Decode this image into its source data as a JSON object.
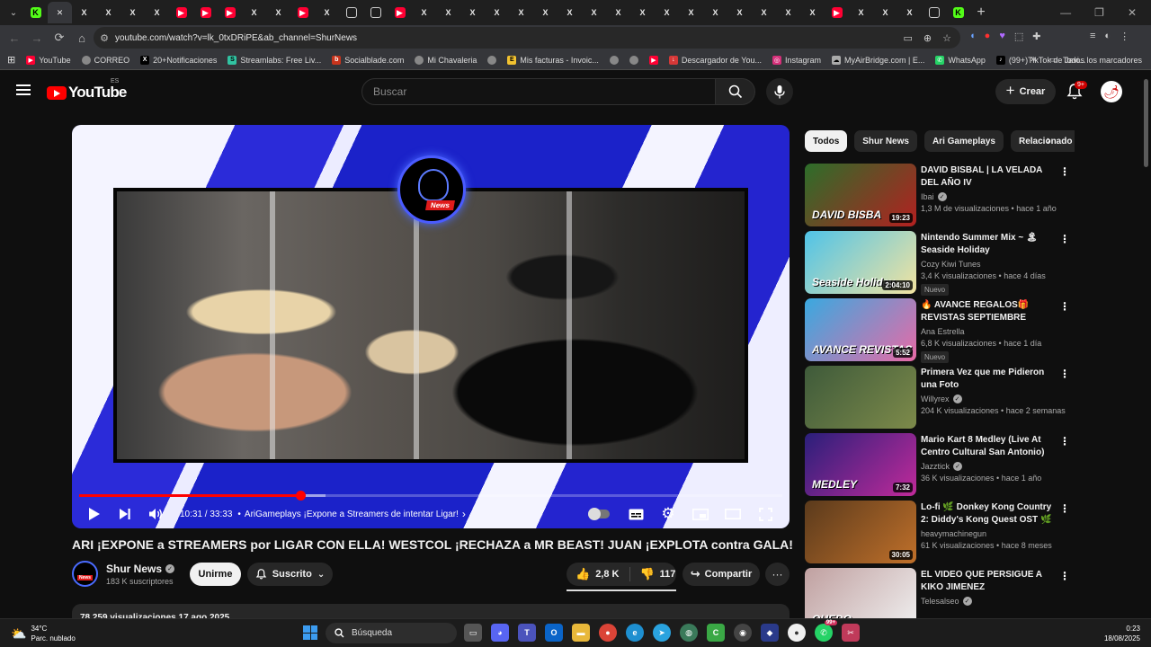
{
  "browser": {
    "tabs": [
      {
        "icon": "k",
        "glyph": "K"
      },
      {
        "icon": "x",
        "glyph": "✕",
        "active": true
      },
      {
        "icon": "x",
        "glyph": "X"
      },
      {
        "icon": "x",
        "glyph": "X"
      },
      {
        "icon": "x",
        "glyph": "X"
      },
      {
        "icon": "x",
        "glyph": "X"
      },
      {
        "icon": "yt",
        "glyph": "▶"
      },
      {
        "icon": "yt",
        "glyph": "▶"
      },
      {
        "icon": "yt",
        "glyph": "▶"
      },
      {
        "icon": "x",
        "glyph": "X"
      },
      {
        "icon": "x",
        "glyph": "X"
      },
      {
        "icon": "yt",
        "glyph": "▶"
      },
      {
        "icon": "x",
        "glyph": "X"
      },
      {
        "icon": "web",
        "glyph": ""
      },
      {
        "icon": "web",
        "glyph": ""
      },
      {
        "icon": "yt",
        "glyph": "▶"
      },
      {
        "icon": "x",
        "glyph": "X"
      },
      {
        "icon": "x",
        "glyph": "X"
      },
      {
        "icon": "x",
        "glyph": "X"
      },
      {
        "icon": "x",
        "glyph": "X"
      },
      {
        "icon": "x",
        "glyph": "X"
      },
      {
        "icon": "x",
        "glyph": "X"
      },
      {
        "icon": "x",
        "glyph": "X"
      },
      {
        "icon": "x",
        "glyph": "X"
      },
      {
        "icon": "x",
        "glyph": "X"
      },
      {
        "icon": "x",
        "glyph": "X"
      },
      {
        "icon": "x",
        "glyph": "X"
      },
      {
        "icon": "x",
        "glyph": "X"
      },
      {
        "icon": "x",
        "glyph": "X"
      },
      {
        "icon": "x",
        "glyph": "X"
      },
      {
        "icon": "x",
        "glyph": "X"
      },
      {
        "icon": "x",
        "glyph": "X"
      },
      {
        "icon": "x",
        "glyph": "X"
      },
      {
        "icon": "yt",
        "glyph": "▶"
      },
      {
        "icon": "x",
        "glyph": "X"
      },
      {
        "icon": "x",
        "glyph": "X"
      },
      {
        "icon": "x",
        "glyph": "X"
      },
      {
        "icon": "web",
        "glyph": ""
      },
      {
        "icon": "k",
        "glyph": "K"
      }
    ],
    "new_tab": "+",
    "url": "youtube.com/watch?v=lk_0txDRiPE&ab_channel=ShurNews",
    "bookmarks": [
      {
        "label": "YouTube",
        "icon": "yt"
      },
      {
        "label": "CORREO",
        "icon": "web"
      },
      {
        "label": "20+Notificaciones",
        "icon": "x"
      },
      {
        "label": "Streamlabs: Free Liv...",
        "icon": "sl"
      },
      {
        "label": "Socialblade.com",
        "icon": "sb"
      },
      {
        "label": "Mi Chavaleria",
        "icon": "web"
      },
      {
        "label": "",
        "icon": "web"
      },
      {
        "label": "Mis facturas - Invoic...",
        "icon": "inv"
      },
      {
        "label": "",
        "icon": "web"
      },
      {
        "label": "",
        "icon": "web"
      },
      {
        "label": "",
        "icon": "yt"
      },
      {
        "label": "Descargador de You...",
        "icon": "dl"
      },
      {
        "label": "Instagram",
        "icon": "ig"
      },
      {
        "label": "MyAirBridge.com | E...",
        "icon": "cloud"
      },
      {
        "label": "WhatsApp",
        "icon": "wa"
      },
      {
        "label": "(99+)TikTok de Javi...",
        "icon": "tt"
      }
    ],
    "bookmarks_more": "»",
    "all_bookmarks": "Todos los marcadores"
  },
  "youtube": {
    "logo_text": "YouTube",
    "country_code": "ES",
    "search_placeholder": "Buscar",
    "create_label": "Crear",
    "notif_count": "9+"
  },
  "player": {
    "current_time": "10:31",
    "duration": "33:33",
    "time_separator": " / ",
    "chapter": "AriGameplays ¡Expone a Streamers de intentar Ligar!",
    "progress_fraction": 0.3152,
    "buffered_fraction": 0.35
  },
  "video": {
    "title": "ARI ¡EXPONE a STREAMERS por LIGAR CON ELLA! WESTCOL ¡RECHAZA a MR BEAST! JUAN ¡EXPLOTA contra GALA!",
    "channel_name": "Shur News",
    "channel_badge": "News",
    "subscribers": "183 K suscriptores",
    "join_label": "Unirme",
    "subscribed_label": "Suscrito",
    "likes": "2,8 K",
    "dislikes": "117",
    "share_label": "Compartir",
    "description_preview": "78.259 visualizaciones 17 ago 2025"
  },
  "chips": [
    "Todos",
    "Shur News",
    "Ari Gameplays",
    "Relacionado"
  ],
  "related": [
    {
      "title": "DAVID BISBAL | LA VELADA DEL AÑO IV",
      "channel": "Ibai",
      "verified": true,
      "meta": "1,3 M de visualizaciones • hace 1 año",
      "duration": "19:23",
      "badge": "",
      "thumb_text": "DAVID BISBA",
      "c1": "#2c6e2a",
      "c2": "#b32020"
    },
    {
      "title": "Nintendo Summer Mix ~ 🏝 Seaside Holiday",
      "channel": "Cozy Kiwi Tunes",
      "verified": false,
      "meta": "3,4 K visualizaciones • hace 4 días",
      "duration": "2:04:10",
      "badge": "Nuevo",
      "thumb_text": "Seaside Holiday",
      "c1": "#4fc3e8",
      "c2": "#f2e3a0"
    },
    {
      "title": "🔥 AVANCE REGALOS🎁 REVISTAS SEPTIEMBRE 2025...",
      "channel": "Ana Estrella",
      "verified": false,
      "meta": "6,8 K visualizaciones • hace 1 día",
      "duration": "5:52",
      "badge": "Nuevo",
      "thumb_text": "AVANCE REVISTAS",
      "c1": "#39a9e0",
      "c2": "#e86aa6"
    },
    {
      "title": "Primera Vez que me Pidieron una Foto",
      "channel": "Willyrex",
      "verified": true,
      "meta": "204 K visualizaciones • hace 2 semanas",
      "duration": "",
      "badge": "",
      "thumb_text": "",
      "c1": "#3e5a3a",
      "c2": "#7d8a4a"
    },
    {
      "title": "Mario Kart 8 Medley (Live At Centro Cultural San Antonio) //...",
      "channel": "Jazztick",
      "verified": true,
      "meta": "36 K visualizaciones • hace 1 año",
      "duration": "7:32",
      "badge": "",
      "thumb_text": "MEDLEY",
      "c1": "#2a1f7a",
      "c2": "#c02a9a"
    },
    {
      "title": "Lo-fi 🌿 Donkey Kong Country 2: Diddy's Kong Quest OST 🌿",
      "channel": "heavymachinegun",
      "verified": false,
      "meta": "61 K visualizaciones • hace 8 meses",
      "duration": "30:05",
      "badge": "",
      "thumb_text": "",
      "c1": "#5a3a1c",
      "c2": "#c0702a"
    },
    {
      "title": "EL VIDEO QUE PERSIGUE A KIKO JIMENEZ",
      "channel": "Telesalseo",
      "verified": true,
      "meta": "",
      "duration": "",
      "badge": "",
      "thumb_text": "QUEDO",
      "c1": "#c0a0a0",
      "c2": "#f0f0f0"
    }
  ],
  "taskbar": {
    "temperature": "34°C",
    "weather": "Parc. nublado",
    "search_label": "Búsqueda",
    "time": "0:23",
    "date": "18/08/2025",
    "whatsapp_badge": "99+"
  },
  "colors": {
    "accent_red": "#ff0000",
    "background": "#0f0f0f",
    "chip_bg": "#272727"
  }
}
